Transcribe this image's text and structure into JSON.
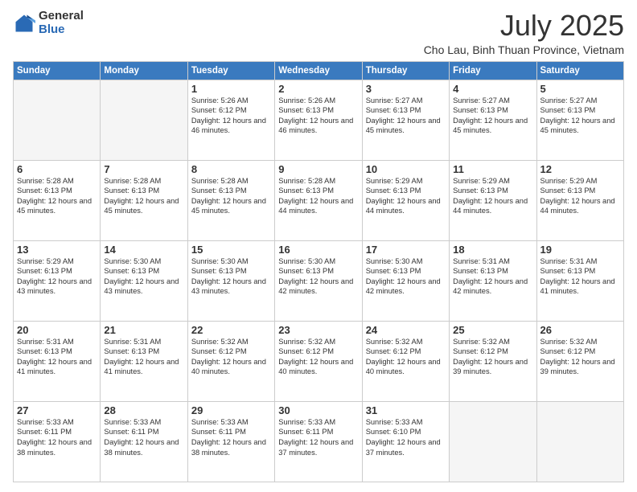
{
  "logo": {
    "general": "General",
    "blue": "Blue"
  },
  "title": "July 2025",
  "location": "Cho Lau, Binh Thuan Province, Vietnam",
  "weekdays": [
    "Sunday",
    "Monday",
    "Tuesday",
    "Wednesday",
    "Thursday",
    "Friday",
    "Saturday"
  ],
  "weeks": [
    [
      {
        "day": "",
        "info": ""
      },
      {
        "day": "",
        "info": ""
      },
      {
        "day": "1",
        "info": "Sunrise: 5:26 AM\nSunset: 6:12 PM\nDaylight: 12 hours\nand 46 minutes."
      },
      {
        "day": "2",
        "info": "Sunrise: 5:26 AM\nSunset: 6:13 PM\nDaylight: 12 hours\nand 46 minutes."
      },
      {
        "day": "3",
        "info": "Sunrise: 5:27 AM\nSunset: 6:13 PM\nDaylight: 12 hours\nand 45 minutes."
      },
      {
        "day": "4",
        "info": "Sunrise: 5:27 AM\nSunset: 6:13 PM\nDaylight: 12 hours\nand 45 minutes."
      },
      {
        "day": "5",
        "info": "Sunrise: 5:27 AM\nSunset: 6:13 PM\nDaylight: 12 hours\nand 45 minutes."
      }
    ],
    [
      {
        "day": "6",
        "info": "Sunrise: 5:28 AM\nSunset: 6:13 PM\nDaylight: 12 hours\nand 45 minutes."
      },
      {
        "day": "7",
        "info": "Sunrise: 5:28 AM\nSunset: 6:13 PM\nDaylight: 12 hours\nand 45 minutes."
      },
      {
        "day": "8",
        "info": "Sunrise: 5:28 AM\nSunset: 6:13 PM\nDaylight: 12 hours\nand 45 minutes."
      },
      {
        "day": "9",
        "info": "Sunrise: 5:28 AM\nSunset: 6:13 PM\nDaylight: 12 hours\nand 44 minutes."
      },
      {
        "day": "10",
        "info": "Sunrise: 5:29 AM\nSunset: 6:13 PM\nDaylight: 12 hours\nand 44 minutes."
      },
      {
        "day": "11",
        "info": "Sunrise: 5:29 AM\nSunset: 6:13 PM\nDaylight: 12 hours\nand 44 minutes."
      },
      {
        "day": "12",
        "info": "Sunrise: 5:29 AM\nSunset: 6:13 PM\nDaylight: 12 hours\nand 44 minutes."
      }
    ],
    [
      {
        "day": "13",
        "info": "Sunrise: 5:29 AM\nSunset: 6:13 PM\nDaylight: 12 hours\nand 43 minutes."
      },
      {
        "day": "14",
        "info": "Sunrise: 5:30 AM\nSunset: 6:13 PM\nDaylight: 12 hours\nand 43 minutes."
      },
      {
        "day": "15",
        "info": "Sunrise: 5:30 AM\nSunset: 6:13 PM\nDaylight: 12 hours\nand 43 minutes."
      },
      {
        "day": "16",
        "info": "Sunrise: 5:30 AM\nSunset: 6:13 PM\nDaylight: 12 hours\nand 42 minutes."
      },
      {
        "day": "17",
        "info": "Sunrise: 5:30 AM\nSunset: 6:13 PM\nDaylight: 12 hours\nand 42 minutes."
      },
      {
        "day": "18",
        "info": "Sunrise: 5:31 AM\nSunset: 6:13 PM\nDaylight: 12 hours\nand 42 minutes."
      },
      {
        "day": "19",
        "info": "Sunrise: 5:31 AM\nSunset: 6:13 PM\nDaylight: 12 hours\nand 41 minutes."
      }
    ],
    [
      {
        "day": "20",
        "info": "Sunrise: 5:31 AM\nSunset: 6:13 PM\nDaylight: 12 hours\nand 41 minutes."
      },
      {
        "day": "21",
        "info": "Sunrise: 5:31 AM\nSunset: 6:13 PM\nDaylight: 12 hours\nand 41 minutes."
      },
      {
        "day": "22",
        "info": "Sunrise: 5:32 AM\nSunset: 6:12 PM\nDaylight: 12 hours\nand 40 minutes."
      },
      {
        "day": "23",
        "info": "Sunrise: 5:32 AM\nSunset: 6:12 PM\nDaylight: 12 hours\nand 40 minutes."
      },
      {
        "day": "24",
        "info": "Sunrise: 5:32 AM\nSunset: 6:12 PM\nDaylight: 12 hours\nand 40 minutes."
      },
      {
        "day": "25",
        "info": "Sunrise: 5:32 AM\nSunset: 6:12 PM\nDaylight: 12 hours\nand 39 minutes."
      },
      {
        "day": "26",
        "info": "Sunrise: 5:32 AM\nSunset: 6:12 PM\nDaylight: 12 hours\nand 39 minutes."
      }
    ],
    [
      {
        "day": "27",
        "info": "Sunrise: 5:33 AM\nSunset: 6:11 PM\nDaylight: 12 hours\nand 38 minutes."
      },
      {
        "day": "28",
        "info": "Sunrise: 5:33 AM\nSunset: 6:11 PM\nDaylight: 12 hours\nand 38 minutes."
      },
      {
        "day": "29",
        "info": "Sunrise: 5:33 AM\nSunset: 6:11 PM\nDaylight: 12 hours\nand 38 minutes."
      },
      {
        "day": "30",
        "info": "Sunrise: 5:33 AM\nSunset: 6:11 PM\nDaylight: 12 hours\nand 37 minutes."
      },
      {
        "day": "31",
        "info": "Sunrise: 5:33 AM\nSunset: 6:10 PM\nDaylight: 12 hours\nand 37 minutes."
      },
      {
        "day": "",
        "info": ""
      },
      {
        "day": "",
        "info": ""
      }
    ]
  ]
}
